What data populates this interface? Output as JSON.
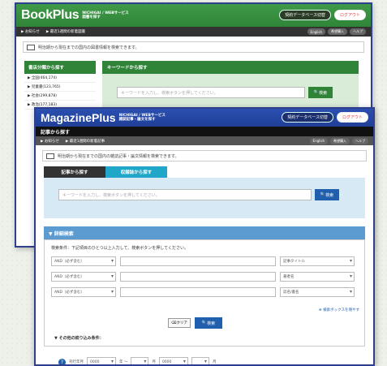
{
  "book": {
    "logo": "BookPlus",
    "logo_sub1": "NICHIGAI / WEBサービス",
    "logo_sub2": "図書を探す",
    "btn_db": "契約データベース切替",
    "btn_logout": "ログアウト",
    "nav": [
      "お知らせ",
      "最近1週間の新着図書"
    ],
    "nav_right": [
      "English",
      "希望購入",
      "ヘルプ"
    ],
    "info": "明治期から現在までの国内の図書情報を検索できます。",
    "left_title": "書店分類から探す",
    "left_items": [
      "▶ 全国(464,174)",
      "▶ 児童書(123,765)",
      "▶ 社会(299,878)",
      "▶ 政治(177,183)"
    ],
    "right_title": "キーワードから探す",
    "search_placeholder": "キーワードを入力し、検索ボタンを押してください。",
    "search_btn": "検索"
  },
  "mag": {
    "logo": "MagazinePlus",
    "logo_sub1": "NICHIGAI / WEBサービス",
    "logo_sub2": "雑誌記事・論文を探す",
    "btn_db": "契約データベース切替",
    "btn_logout": "ログアウト",
    "subtitle": "記事から探す",
    "nav": [
      "お知らせ",
      "最近1週間の新着記事"
    ],
    "nav_right": [
      "English",
      "希望購入",
      "ヘルプ"
    ],
    "info": "明治期から現在までの国内の雑誌記事・論文情報を検索できます。",
    "tabs": [
      "記事から探す",
      "収録誌から探す"
    ],
    "search_placeholder": "キーワードを入力し、検索ボタンを押してください。",
    "search_btn": "検索",
    "adv_title": "▼ 詳細検索",
    "adv_cond": "検索条件：下記項目のひとつ以上入力して、検索ボタンを押してください。",
    "op": "AND（必ず含む）",
    "fields": [
      "記事タイトル",
      "著者名",
      "誌名/書名"
    ],
    "add_box": "⊕ 検索ボックスを増やす",
    "clear_btn": "クリア",
    "go_btn": "検索",
    "other_title": "▼ その他の絞り込み条件：",
    "pub_label": "刊行年月",
    "y1": "0000",
    "m1": "月",
    "range": "年 〜",
    "y2": "0000",
    "m2": "月"
  }
}
